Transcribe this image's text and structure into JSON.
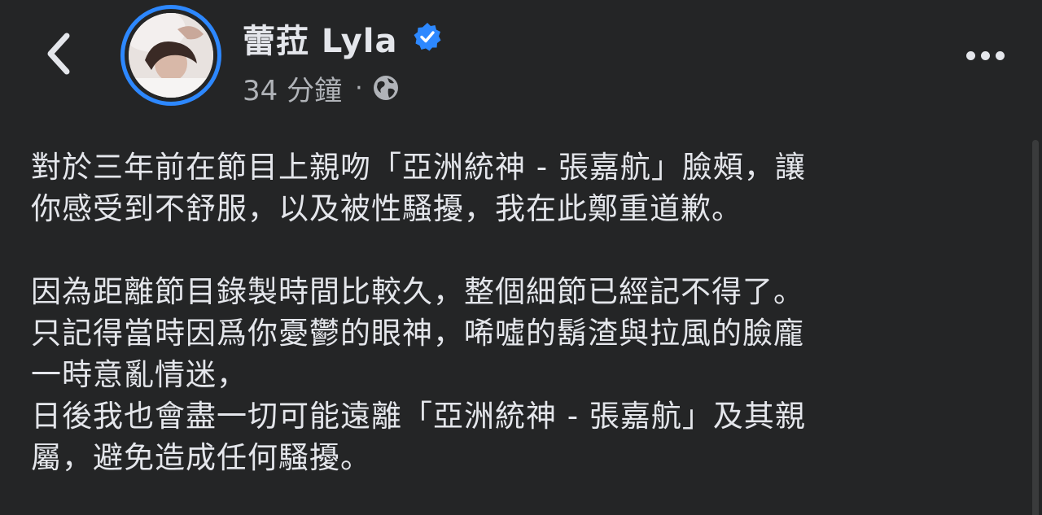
{
  "header": {
    "author_name": "蕾菈 Lyla",
    "timestamp": "34 分鐘",
    "separator": "·",
    "privacy_icon": "globe-icon",
    "verified_icon": "verified-badge-icon",
    "back_icon": "chevron-left-icon",
    "more_icon": "more-options-icon"
  },
  "post": {
    "lines": [
      "對於三年前在節目上親吻「亞洲統神 - 張嘉航」臉頰，讓",
      "你感受到不舒服，以及被性騷擾，我在此鄭重道歉。",
      "",
      "因為距離節目錄製時間比較久，整個細節已經記不得了。",
      "只記得當時因爲你憂鬱的眼神，唏噓的鬍渣與拉風的臉龐",
      "一時意亂情迷，",
      "日後我也會盡一切可能遠離「亞洲統神 - 張嘉航」及其親",
      "屬，避免造成任何騷擾。"
    ]
  },
  "colors": {
    "background": "#242526",
    "primary_text": "#e4e6eb",
    "secondary_text": "#b0b3b8",
    "accent": "#2d88ff"
  }
}
